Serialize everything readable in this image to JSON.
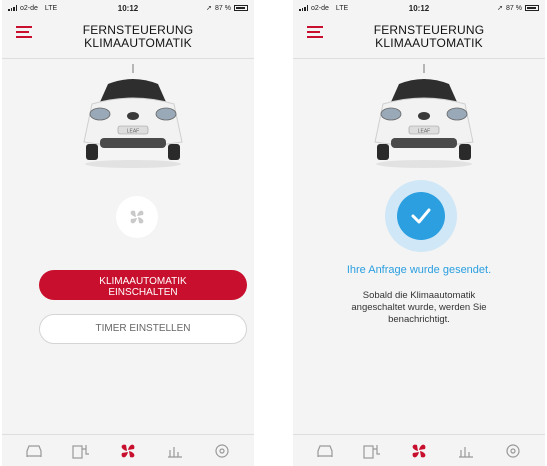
{
  "status": {
    "carrier": "o2-de",
    "network": "LTE",
    "time": "10:12",
    "battery": "87 %"
  },
  "header": {
    "title_line1": "FERNSTEUERUNG",
    "title_line2": "KLIMAAUTOMATIK"
  },
  "car": {
    "badge": "LEAF"
  },
  "screen_left": {
    "button_primary_line1": "KLIMAAUTOMATIK",
    "button_primary_line2": "EINSCHALTEN",
    "button_secondary": "TIMER EINSTELLEN"
  },
  "screen_right": {
    "success_title": "Ihre Anfrage wurde gesendet.",
    "success_body_line1": "Sobald die Klimaautomatik",
    "success_body_line2": "angeschaltet wurde, werden Sie",
    "success_body_line3": "benachrichtigt."
  },
  "nav": {
    "items": [
      "car-icon",
      "charging-icon",
      "fan-icon",
      "stats-icon",
      "location-icon"
    ],
    "active": "fan-icon"
  },
  "colors": {
    "accent_red": "#c8102e",
    "accent_blue": "#2b9fe0",
    "light_blue": "#cfe7f6",
    "background": "#f4f4f4"
  }
}
